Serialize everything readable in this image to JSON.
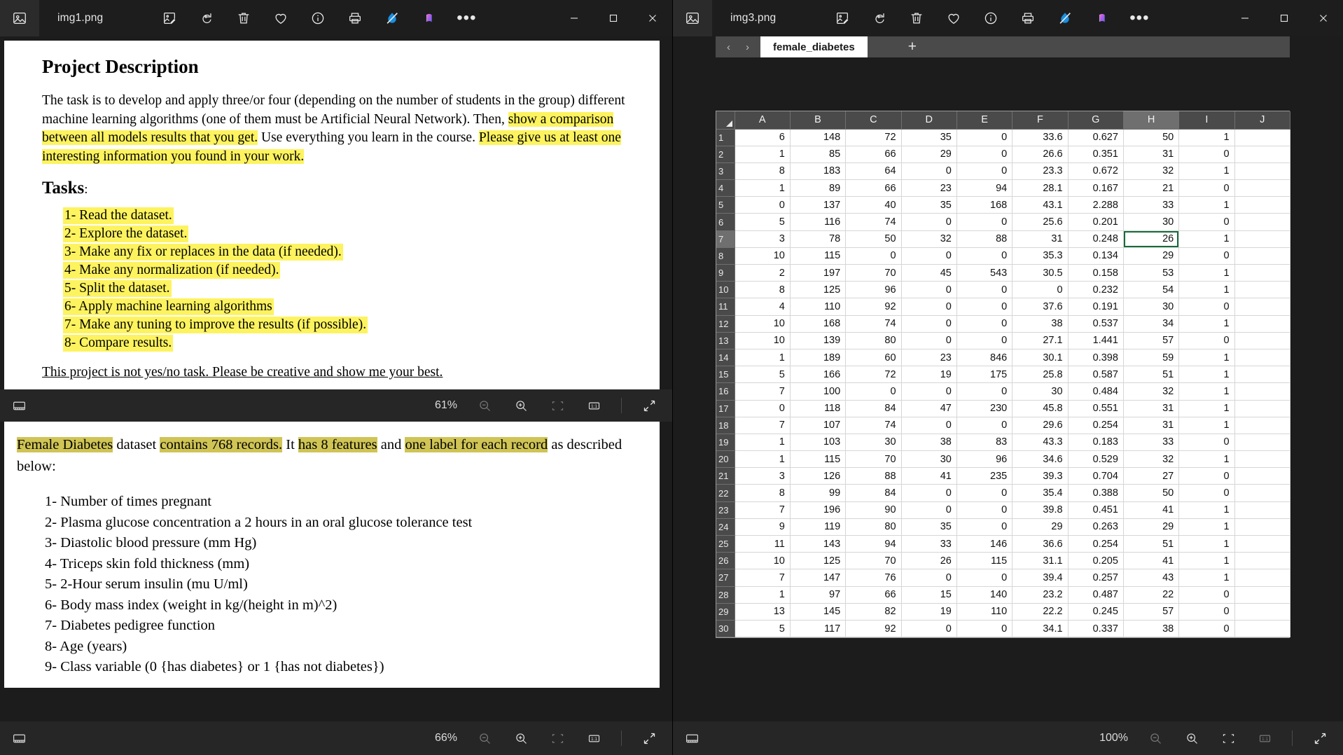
{
  "windows": {
    "left": {
      "title": "img1.png",
      "toolbar_icons": [
        "edit-image-icon",
        "rotate-icon",
        "delete-icon",
        "favorite-icon",
        "info-icon",
        "print-icon",
        "background-remove-icon",
        "visual-search-icon",
        "more-options-icon"
      ],
      "window_controls": [
        "minimize",
        "maximize",
        "close"
      ],
      "doc_top": {
        "heading": "Project Description",
        "paragraph": [
          {
            "t": "The task is to develop and apply three/or four (depending on the number of students in the group) different machine learning algorithms (one of them must be Artificial Neural Network). Then, ",
            "h": false
          },
          {
            "t": "show a comparison between all models results that you get.",
            "h": true
          },
          {
            "t": " Use everything you learn in the course. ",
            "h": false
          },
          {
            "t": "Please give us at least one interesting information you found in your work.",
            "h": true
          }
        ],
        "tasks_heading": "Tasks",
        "tasks_heading_suffix": ":",
        "tasks": [
          "1-  Read the dataset.",
          "2-  Explore the dataset.",
          "3-  Make any fix or replaces in the data (if needed).",
          "4-  Make any normalization (if needed).",
          "5-  Split the dataset.",
          "6-  Apply machine learning algorithms",
          "7-  Make any tuning to improve the results (if possible).",
          "8-  Compare results."
        ],
        "closing": "This project is not yes/no task. Please be creative and show me your best."
      },
      "status_mid": {
        "zoom": "61%"
      },
      "doc_bottom": {
        "paragraph": [
          {
            "t": "Female Diabetes",
            "h": true
          },
          {
            "t": " dataset ",
            "h": false
          },
          {
            "t": "contains 768 records.",
            "h": true
          },
          {
            "t": " It ",
            "h": false
          },
          {
            "t": "has 8 features",
            "h": true
          },
          {
            "t": " and ",
            "h": false
          },
          {
            "t": "one label for each record",
            "h": true
          },
          {
            "t": " as described below:",
            "h": false
          }
        ],
        "features": [
          "1-  Number of times pregnant",
          "2-  Plasma glucose concentration a 2 hours in an oral glucose tolerance test",
          "3-  Diastolic blood pressure (mm Hg)",
          "4-  Triceps skin fold thickness (mm)",
          "5-  2-Hour serum insulin (mu U/ml)",
          "6-  Body mass index (weight in kg/(height in m)^2)",
          "7-  Diabetes pedigree function",
          "8-  Age (years)",
          "9-  Class variable (0 {has diabetes} or 1 {has not diabetes})"
        ]
      },
      "status_bottom": {
        "zoom": "66%"
      }
    },
    "right": {
      "title": "img3.png",
      "toolbar_icons": [
        "edit-image-icon",
        "rotate-icon",
        "delete-icon",
        "favorite-icon",
        "info-icon",
        "print-icon",
        "background-remove-icon",
        "visual-search-icon",
        "more-options-icon"
      ],
      "status_bottom": {
        "zoom": "100%"
      },
      "sheet": {
        "columns": [
          "A",
          "B",
          "C",
          "D",
          "E",
          "F",
          "G",
          "H",
          "I",
          "J"
        ],
        "selected_column": "H",
        "active_cell": {
          "row": 7,
          "col": "H"
        },
        "rows": [
          {
            "n": "1",
            "c": [
              "6",
              "148",
              "72",
              "35",
              "0",
              "33.6",
              "0.627",
              "50",
              "1",
              ""
            ]
          },
          {
            "n": "2",
            "c": [
              "1",
              "85",
              "66",
              "29",
              "0",
              "26.6",
              "0.351",
              "31",
              "0",
              ""
            ]
          },
          {
            "n": "3",
            "c": [
              "8",
              "183",
              "64",
              "0",
              "0",
              "23.3",
              "0.672",
              "32",
              "1",
              ""
            ]
          },
          {
            "n": "4",
            "c": [
              "1",
              "89",
              "66",
              "23",
              "94",
              "28.1",
              "0.167",
              "21",
              "0",
              ""
            ]
          },
          {
            "n": "5",
            "c": [
              "0",
              "137",
              "40",
              "35",
              "168",
              "43.1",
              "2.288",
              "33",
              "1",
              ""
            ]
          },
          {
            "n": "6",
            "c": [
              "5",
              "116",
              "74",
              "0",
              "0",
              "25.6",
              "0.201",
              "30",
              "0",
              ""
            ]
          },
          {
            "n": "7",
            "c": [
              "3",
              "78",
              "50",
              "32",
              "88",
              "31",
              "0.248",
              "26",
              "1",
              ""
            ]
          },
          {
            "n": "8",
            "c": [
              "10",
              "115",
              "0",
              "0",
              "0",
              "35.3",
              "0.134",
              "29",
              "0",
              ""
            ]
          },
          {
            "n": "9",
            "c": [
              "2",
              "197",
              "70",
              "45",
              "543",
              "30.5",
              "0.158",
              "53",
              "1",
              ""
            ]
          },
          {
            "n": "10",
            "c": [
              "8",
              "125",
              "96",
              "0",
              "0",
              "0",
              "0.232",
              "54",
              "1",
              ""
            ]
          },
          {
            "n": "11",
            "c": [
              "4",
              "110",
              "92",
              "0",
              "0",
              "37.6",
              "0.191",
              "30",
              "0",
              ""
            ]
          },
          {
            "n": "12",
            "c": [
              "10",
              "168",
              "74",
              "0",
              "0",
              "38",
              "0.537",
              "34",
              "1",
              ""
            ]
          },
          {
            "n": "13",
            "c": [
              "10",
              "139",
              "80",
              "0",
              "0",
              "27.1",
              "1.441",
              "57",
              "0",
              ""
            ]
          },
          {
            "n": "14",
            "c": [
              "1",
              "189",
              "60",
              "23",
              "846",
              "30.1",
              "0.398",
              "59",
              "1",
              ""
            ]
          },
          {
            "n": "15",
            "c": [
              "5",
              "166",
              "72",
              "19",
              "175",
              "25.8",
              "0.587",
              "51",
              "1",
              ""
            ]
          },
          {
            "n": "16",
            "c": [
              "7",
              "100",
              "0",
              "0",
              "0",
              "30",
              "0.484",
              "32",
              "1",
              ""
            ]
          },
          {
            "n": "17",
            "c": [
              "0",
              "118",
              "84",
              "47",
              "230",
              "45.8",
              "0.551",
              "31",
              "1",
              ""
            ]
          },
          {
            "n": "18",
            "c": [
              "7",
              "107",
              "74",
              "0",
              "0",
              "29.6",
              "0.254",
              "31",
              "1",
              ""
            ]
          },
          {
            "n": "19",
            "c": [
              "1",
              "103",
              "30",
              "38",
              "83",
              "43.3",
              "0.183",
              "33",
              "0",
              ""
            ]
          },
          {
            "n": "20",
            "c": [
              "1",
              "115",
              "70",
              "30",
              "96",
              "34.6",
              "0.529",
              "32",
              "1",
              ""
            ]
          },
          {
            "n": "21",
            "c": [
              "3",
              "126",
              "88",
              "41",
              "235",
              "39.3",
              "0.704",
              "27",
              "0",
              ""
            ]
          },
          {
            "n": "22",
            "c": [
              "8",
              "99",
              "84",
              "0",
              "0",
              "35.4",
              "0.388",
              "50",
              "0",
              ""
            ]
          },
          {
            "n": "23",
            "c": [
              "7",
              "196",
              "90",
              "0",
              "0",
              "39.8",
              "0.451",
              "41",
              "1",
              ""
            ]
          },
          {
            "n": "24",
            "c": [
              "9",
              "119",
              "80",
              "35",
              "0",
              "29",
              "0.263",
              "29",
              "1",
              ""
            ]
          },
          {
            "n": "25",
            "c": [
              "11",
              "143",
              "94",
              "33",
              "146",
              "36.6",
              "0.254",
              "51",
              "1",
              ""
            ]
          },
          {
            "n": "26",
            "c": [
              "10",
              "125",
              "70",
              "26",
              "115",
              "31.1",
              "0.205",
              "41",
              "1",
              ""
            ]
          },
          {
            "n": "27",
            "c": [
              "7",
              "147",
              "76",
              "0",
              "0",
              "39.4",
              "0.257",
              "43",
              "1",
              ""
            ]
          },
          {
            "n": "28",
            "c": [
              "1",
              "97",
              "66",
              "15",
              "140",
              "23.2",
              "0.487",
              "22",
              "0",
              ""
            ]
          },
          {
            "n": "29",
            "c": [
              "13",
              "145",
              "82",
              "19",
              "110",
              "22.2",
              "0.245",
              "57",
              "0",
              ""
            ]
          },
          {
            "n": "30",
            "c": [
              "5",
              "117",
              "92",
              "0",
              "0",
              "34.1",
              "0.337",
              "38",
              "0",
              ""
            ]
          }
        ],
        "tab_name": "female_diabetes",
        "tab_prev": "‹",
        "tab_next": "›",
        "tab_add": "+"
      }
    }
  },
  "status_icons": [
    "filmstrip-icon",
    "zoom-out-icon",
    "zoom-in-icon",
    "fit-to-window-icon",
    "actual-size-icon",
    "fullscreen-icon"
  ],
  "colors": {
    "highlight_yellow": "#fdf35f",
    "highlight_olive": "#cfc455",
    "chrome_dark": "#1c1c1c",
    "status_bar": "#262626",
    "sheet_header": "#4a4a4a",
    "cell_select": "#176b3a"
  }
}
